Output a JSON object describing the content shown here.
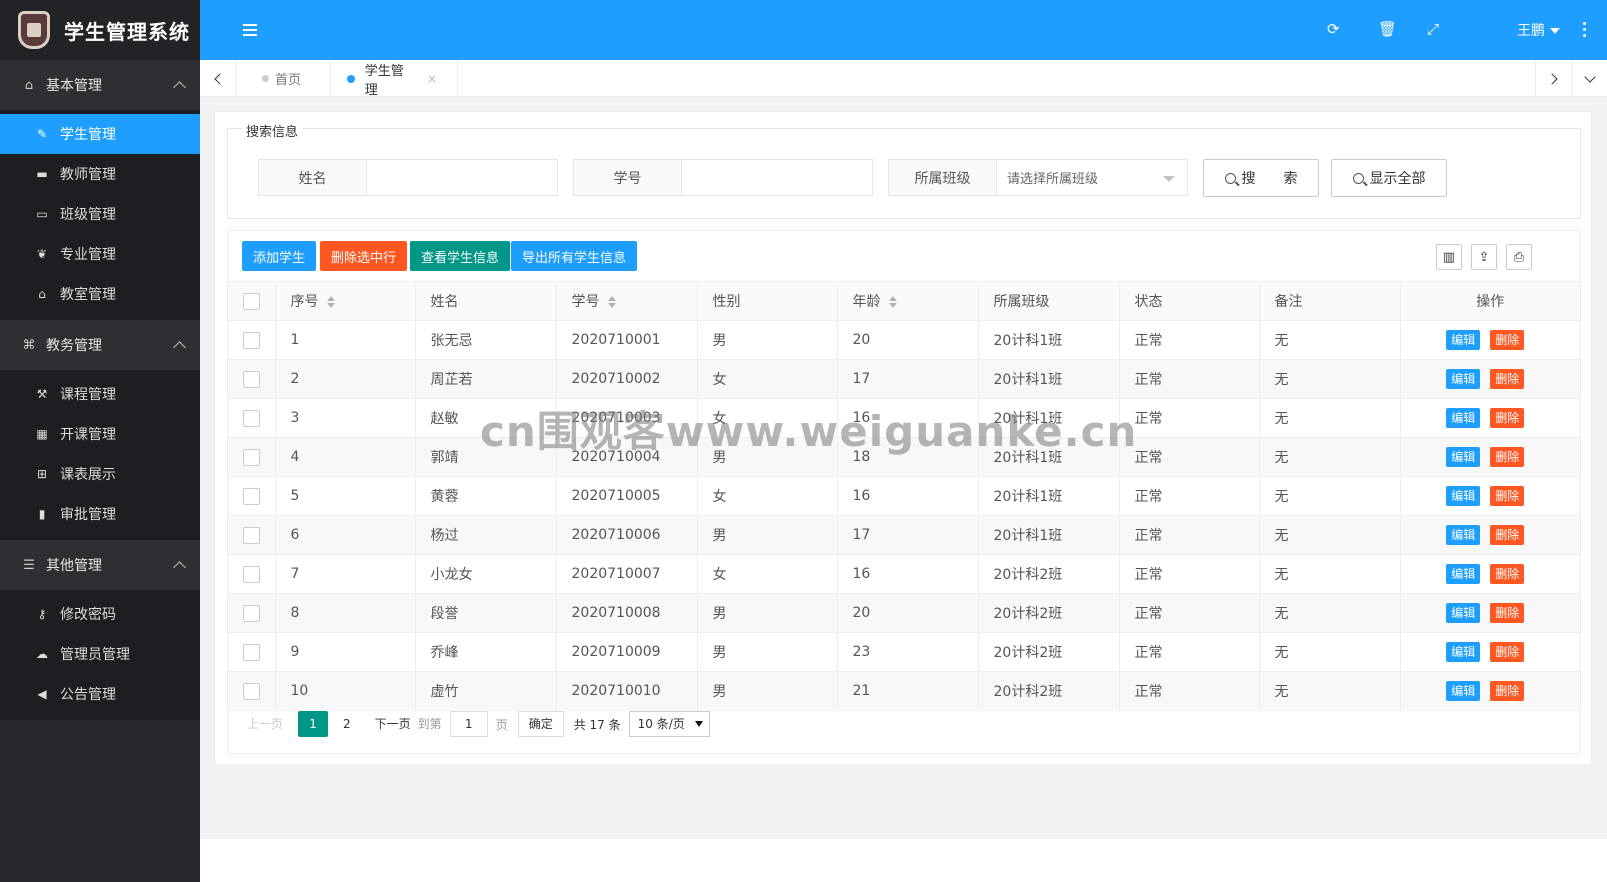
{
  "brand": {
    "title": "学生管理系统"
  },
  "sidebar": {
    "groups": [
      {
        "label": "基本管理",
        "icon": "home-icon",
        "items": [
          {
            "label": "学生管理",
            "icon": "pencil-icon",
            "active": true
          },
          {
            "label": "教师管理",
            "icon": "briefcase-icon"
          },
          {
            "label": "班级管理",
            "icon": "window-icon"
          },
          {
            "label": "专业管理",
            "icon": "leaf-icon"
          },
          {
            "label": "教室管理",
            "icon": "bank-icon"
          }
        ]
      },
      {
        "label": "教务管理",
        "icon": "graduation-cap-icon",
        "items": [
          {
            "label": "课程管理",
            "icon": "gavel-icon"
          },
          {
            "label": "开课管理",
            "icon": "calendar-icon"
          },
          {
            "label": "课表展示",
            "icon": "table-icon"
          },
          {
            "label": "审批管理",
            "icon": "book-icon"
          }
        ]
      },
      {
        "label": "其他管理",
        "icon": "bars-icon",
        "items": [
          {
            "label": "修改密码",
            "icon": "key-icon"
          },
          {
            "label": "管理员管理",
            "icon": "cloud-icon"
          },
          {
            "label": "公告管理",
            "icon": "bullhorn-icon"
          }
        ]
      }
    ]
  },
  "header": {
    "user": "王鹏",
    "accent": "#1e9fff"
  },
  "tabs": [
    {
      "label": "首页"
    },
    {
      "label": "学生管理",
      "close": "×"
    }
  ],
  "search": {
    "legend": "搜索信息",
    "name_label": "姓名",
    "name_value": "",
    "id_label": "学号",
    "id_value": "",
    "class_label": "所属班级",
    "class_placeholder": "请选择所属班级",
    "search_btn": "搜　　索",
    "show_all_btn": "显示全部"
  },
  "toolbar": {
    "add": "添加学生",
    "delete_selected": "删除选中行",
    "view": "查看学生信息",
    "export": "导出所有学生信息"
  },
  "table": {
    "headers": [
      "序号",
      "姓名",
      "学号",
      "性别",
      "年龄",
      "所属班级",
      "状态",
      "备注",
      "操作"
    ],
    "edit_label": "编辑",
    "delete_label": "删除",
    "rows": [
      [
        "1",
        "张无忌",
        "2020710001",
        "男",
        "20",
        "20计科1班",
        "正常",
        "无"
      ],
      [
        "2",
        "周芷若",
        "2020710002",
        "女",
        "17",
        "20计科1班",
        "正常",
        "无"
      ],
      [
        "3",
        "赵敏",
        "2020710003",
        "女",
        "16",
        "20计科1班",
        "正常",
        "无"
      ],
      [
        "4",
        "郭靖",
        "2020710004",
        "男",
        "18",
        "20计科1班",
        "正常",
        "无"
      ],
      [
        "5",
        "黄蓉",
        "2020710005",
        "女",
        "16",
        "20计科1班",
        "正常",
        "无"
      ],
      [
        "6",
        "杨过",
        "2020710006",
        "男",
        "17",
        "20计科1班",
        "正常",
        "无"
      ],
      [
        "7",
        "小龙女",
        "2020710007",
        "女",
        "16",
        "20计科2班",
        "正常",
        "无"
      ],
      [
        "8",
        "段誉",
        "2020710008",
        "男",
        "20",
        "20计科2班",
        "正常",
        "无"
      ],
      [
        "9",
        "乔峰",
        "2020710009",
        "男",
        "23",
        "20计科2班",
        "正常",
        "无"
      ],
      [
        "10",
        "虚竹",
        "2020710010",
        "男",
        "21",
        "20计科2班",
        "正常",
        "无"
      ]
    ]
  },
  "pager": {
    "prev": "上一页",
    "current": "1",
    "page2": "2",
    "next": "下一页",
    "goto": "到第",
    "goto_value": "1",
    "page_unit": "页",
    "confirm": "确定",
    "total": "共 17 条",
    "limit": "10 条/页"
  },
  "watermark": "cn围观客www.weiguanke.cn"
}
